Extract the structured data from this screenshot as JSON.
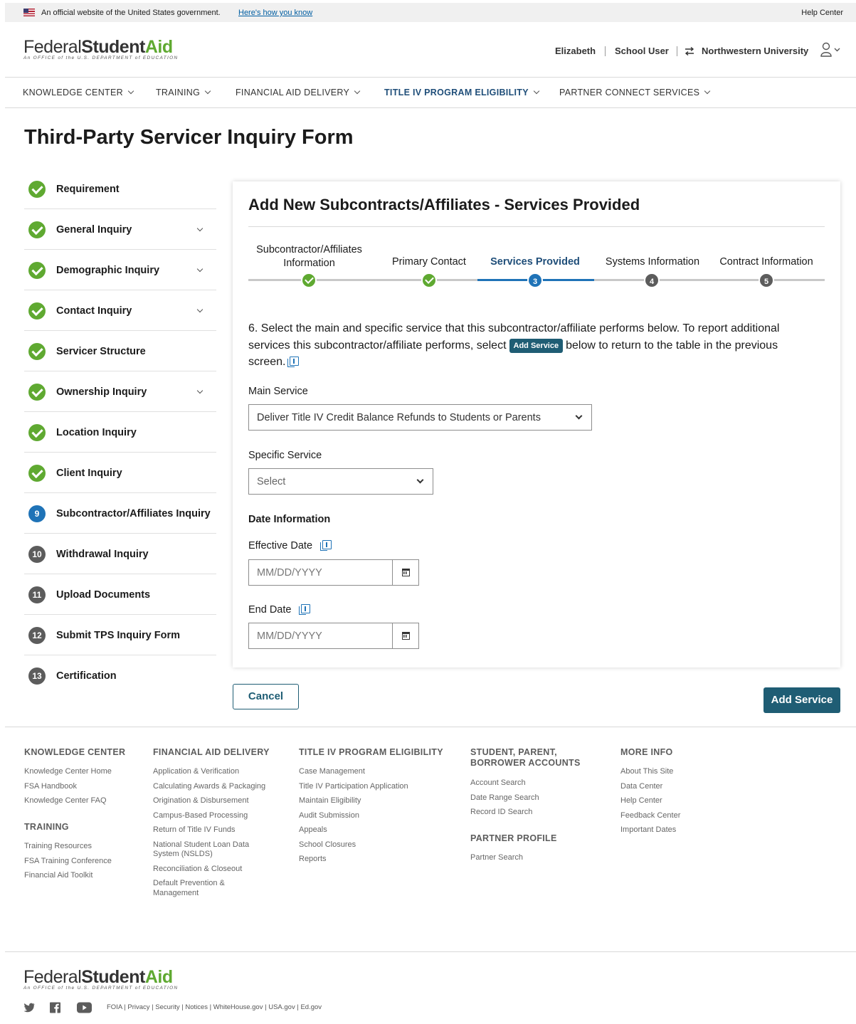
{
  "gov_banner": {
    "official": "An official website of the United States government.",
    "how_know": "Here's how you know",
    "help": "Help Center"
  },
  "brand": {
    "federal": "Federal",
    "student": "Student",
    "aid": "Aid",
    "tagline": "An OFFICE of the U.S. DEPARTMENT of EDUCATION"
  },
  "user": {
    "name": "Elizabeth",
    "role": "School User",
    "org": "Northwestern University"
  },
  "nav": [
    {
      "label": "KNOWLEDGE CENTER"
    },
    {
      "label": "TRAINING"
    },
    {
      "label": "FINANCIAL AID DELIVERY"
    },
    {
      "label": "TITLE IV PROGRAM ELIGIBILITY"
    },
    {
      "label": "PARTNER CONNECT SERVICES"
    }
  ],
  "page_title": "Third-Party Servicer Inquiry Form",
  "steps": [
    {
      "label": "Requirement",
      "state": "done"
    },
    {
      "label": "General Inquiry",
      "state": "done"
    },
    {
      "label": "Demographic Inquiry",
      "state": "done"
    },
    {
      "label": "Contact Inquiry",
      "state": "done"
    },
    {
      "label": "Servicer Structure",
      "state": "done"
    },
    {
      "label": "Ownership Inquiry",
      "state": "done"
    },
    {
      "label": "Location Inquiry",
      "state": "done"
    },
    {
      "label": "Client Inquiry",
      "state": "done"
    },
    {
      "label": "Subcontractor/Affiliates Inquiry",
      "state": "current",
      "num": "9"
    },
    {
      "label": "Withdrawal Inquiry",
      "state": "todo",
      "num": "10"
    },
    {
      "label": "Upload Documents",
      "state": "todo",
      "num": "11"
    },
    {
      "label": "Submit TPS Inquiry Form",
      "state": "todo",
      "num": "12"
    },
    {
      "label": "Certification",
      "state": "todo",
      "num": "13"
    }
  ],
  "card": {
    "title": "Add New Subcontracts/Affiliates - Services Provided",
    "progress": [
      {
        "label": "Subcontractor/Affiliates Information",
        "state": "done"
      },
      {
        "label": "Primary Contact",
        "state": "done"
      },
      {
        "label": "Services Provided",
        "state": "current",
        "num": "3"
      },
      {
        "label": "Systems Information",
        "state": "todo",
        "num": "4"
      },
      {
        "label": "Contract Information",
        "state": "todo",
        "num": "5"
      }
    ],
    "question_a": "6. Select the main and specific service that this subcontractor/affiliate performs below. To report additional services this subcontractor/affiliate performs, select",
    "question_pill": "Add Service",
    "question_b": "below to return to the table in the previous screen.",
    "main_service_label": "Main Service",
    "main_service_value": "Deliver Title IV Credit Balance Refunds to Students or Parents",
    "specific_service_label": "Specific Service",
    "specific_service_value": "Select",
    "date_section": "Date Information",
    "effective_label": "Effective Date",
    "effective_placeholder": "MM/DD/YYYY",
    "end_label": "End Date",
    "end_placeholder": "MM/DD/YYYY"
  },
  "buttons": {
    "cancel": "Cancel",
    "add": "Add Service"
  },
  "footer": {
    "knowledge": {
      "title": "KNOWLEDGE CENTER",
      "links": [
        "Knowledge Center Home",
        "FSA Handbook",
        "Knowledge Center FAQ"
      ]
    },
    "training": {
      "title": "TRAINING",
      "links": [
        "Training Resources",
        "FSA Training Conference",
        "Financial Aid Toolkit"
      ]
    },
    "fad": {
      "title": "FINANCIAL AID DELIVERY",
      "links": [
        "Application & Verification",
        "Calculating Awards & Packaging",
        "Origination & Disbursement",
        "Campus-Based Processing",
        "Return of Title IV Funds",
        "National Student Loan Data System (NSLDS)",
        "Reconciliation & Closeout",
        "Default Prevention & Management"
      ]
    },
    "t4": {
      "title": "TITLE IV PROGRAM ELIGIBILITY",
      "links": [
        "Case Management",
        "Title IV Participation Application",
        "Maintain Eligibility",
        "Audit Submission",
        "Appeals",
        "School Closures",
        "Reports"
      ]
    },
    "spb": {
      "title": "STUDENT, PARENT, BORROWER ACCOUNTS",
      "links": [
        "Account Search",
        "Date Range Search",
        "Record ID Search"
      ]
    },
    "partner": {
      "title": "PARTNER PROFILE",
      "links": [
        "Partner Search"
      ]
    },
    "more": {
      "title": "MORE INFO",
      "links": [
        "About This Site",
        "Data Center",
        "Help Center",
        "Feedback Center",
        "Important Dates"
      ]
    },
    "legal": "FOIA | Privacy | Security | Notices | WhiteHouse.gov | USA.gov | Ed.gov"
  }
}
